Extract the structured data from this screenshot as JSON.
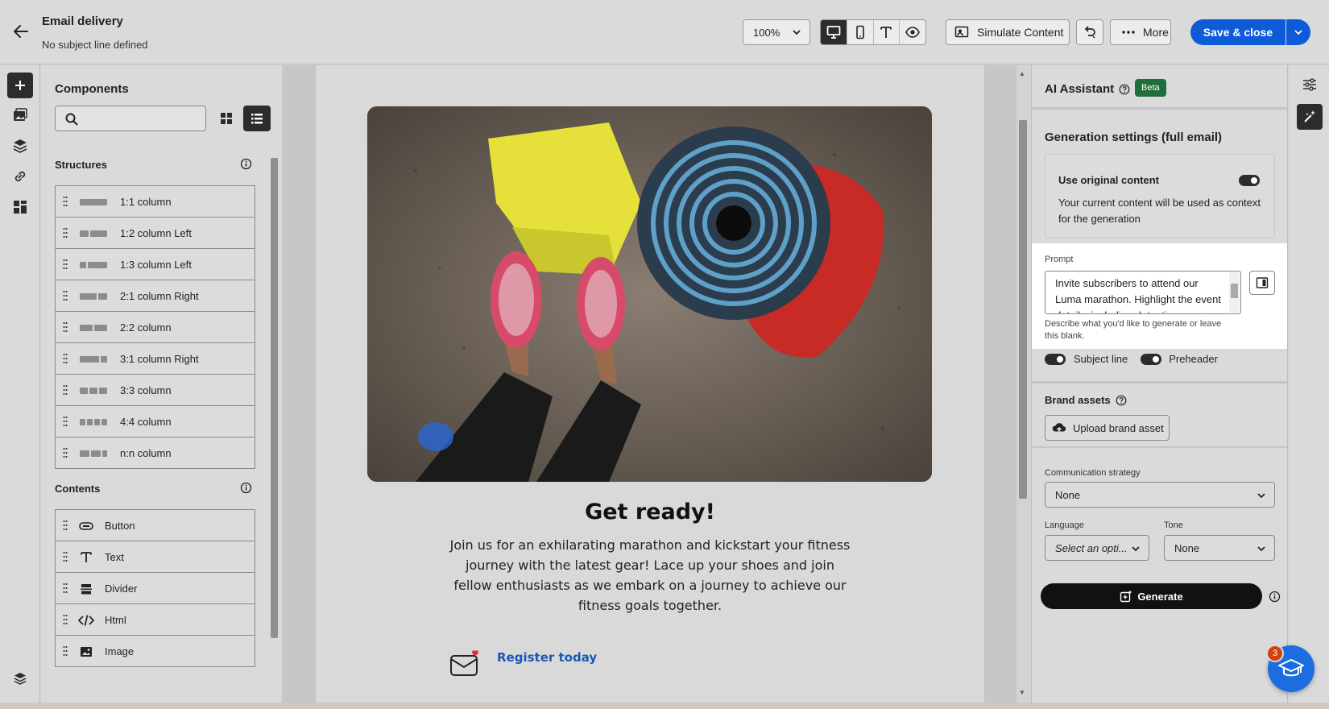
{
  "header": {
    "title": "Email delivery",
    "subtitle": "No subject line defined",
    "zoom": "100%",
    "simulate_label": "Simulate Content",
    "more_label": "More",
    "save_label": "Save & close"
  },
  "components": {
    "title": "Components",
    "search_placeholder": "",
    "structures_title": "Structures",
    "structures": [
      {
        "label": "1:1 column",
        "cols": [
          1
        ]
      },
      {
        "label": "1:2 column Left",
        "cols": [
          1,
          2
        ]
      },
      {
        "label": "1:3 column Left",
        "cols": [
          1,
          3
        ]
      },
      {
        "label": "2:1 column Right",
        "cols": [
          2,
          1
        ]
      },
      {
        "label": "2:2 column",
        "cols": [
          1,
          1
        ]
      },
      {
        "label": "3:1 column Right",
        "cols": [
          3,
          1
        ]
      },
      {
        "label": "3:3 column",
        "cols": [
          1,
          1,
          1
        ]
      },
      {
        "label": "4:4 column",
        "cols": [
          1,
          1,
          1,
          1
        ]
      },
      {
        "label": "n:n column",
        "cols": [
          1,
          1,
          0.5
        ]
      }
    ],
    "contents_title": "Contents",
    "contents": [
      {
        "label": "Button",
        "icon": "button-icon"
      },
      {
        "label": "Text",
        "icon": "text-icon"
      },
      {
        "label": "Divider",
        "icon": "divider-icon"
      },
      {
        "label": "Html",
        "icon": "code-icon"
      },
      {
        "label": "Image",
        "icon": "image-icon"
      }
    ]
  },
  "email": {
    "headline": "Get ready!",
    "body": "Join us for an exhilarating marathon and kickstart your fitness journey with the latest gear! Lace up your shoes and join fellow enthusiasts as we embark on a journey to achieve our fitness goals together.",
    "cta": "Register today"
  },
  "ai": {
    "title": "AI Assistant",
    "beta": "Beta",
    "generation_title": "Generation settings (full email)",
    "use_original_title": "Use original content",
    "use_original_desc": "Your current content will be used as context for the generation",
    "prompt_label": "Prompt",
    "prompt_text": "Invite subscribers to attend our Luma marathon. Highlight the event details, including date, time",
    "prompt_help": "Describe what you'd like to generate or leave this blank.",
    "subject_line_label": "Subject line",
    "preheader_label": "Preheader",
    "brand_assets_title": "Brand assets",
    "upload_label": "Upload brand asset",
    "strategy_label": "Communication strategy",
    "strategy_value": "None",
    "language_label": "Language",
    "language_value": "Select an opti...",
    "tone_label": "Tone",
    "tone_value": "None",
    "generate_label": "Generate"
  },
  "help_badge": "3"
}
